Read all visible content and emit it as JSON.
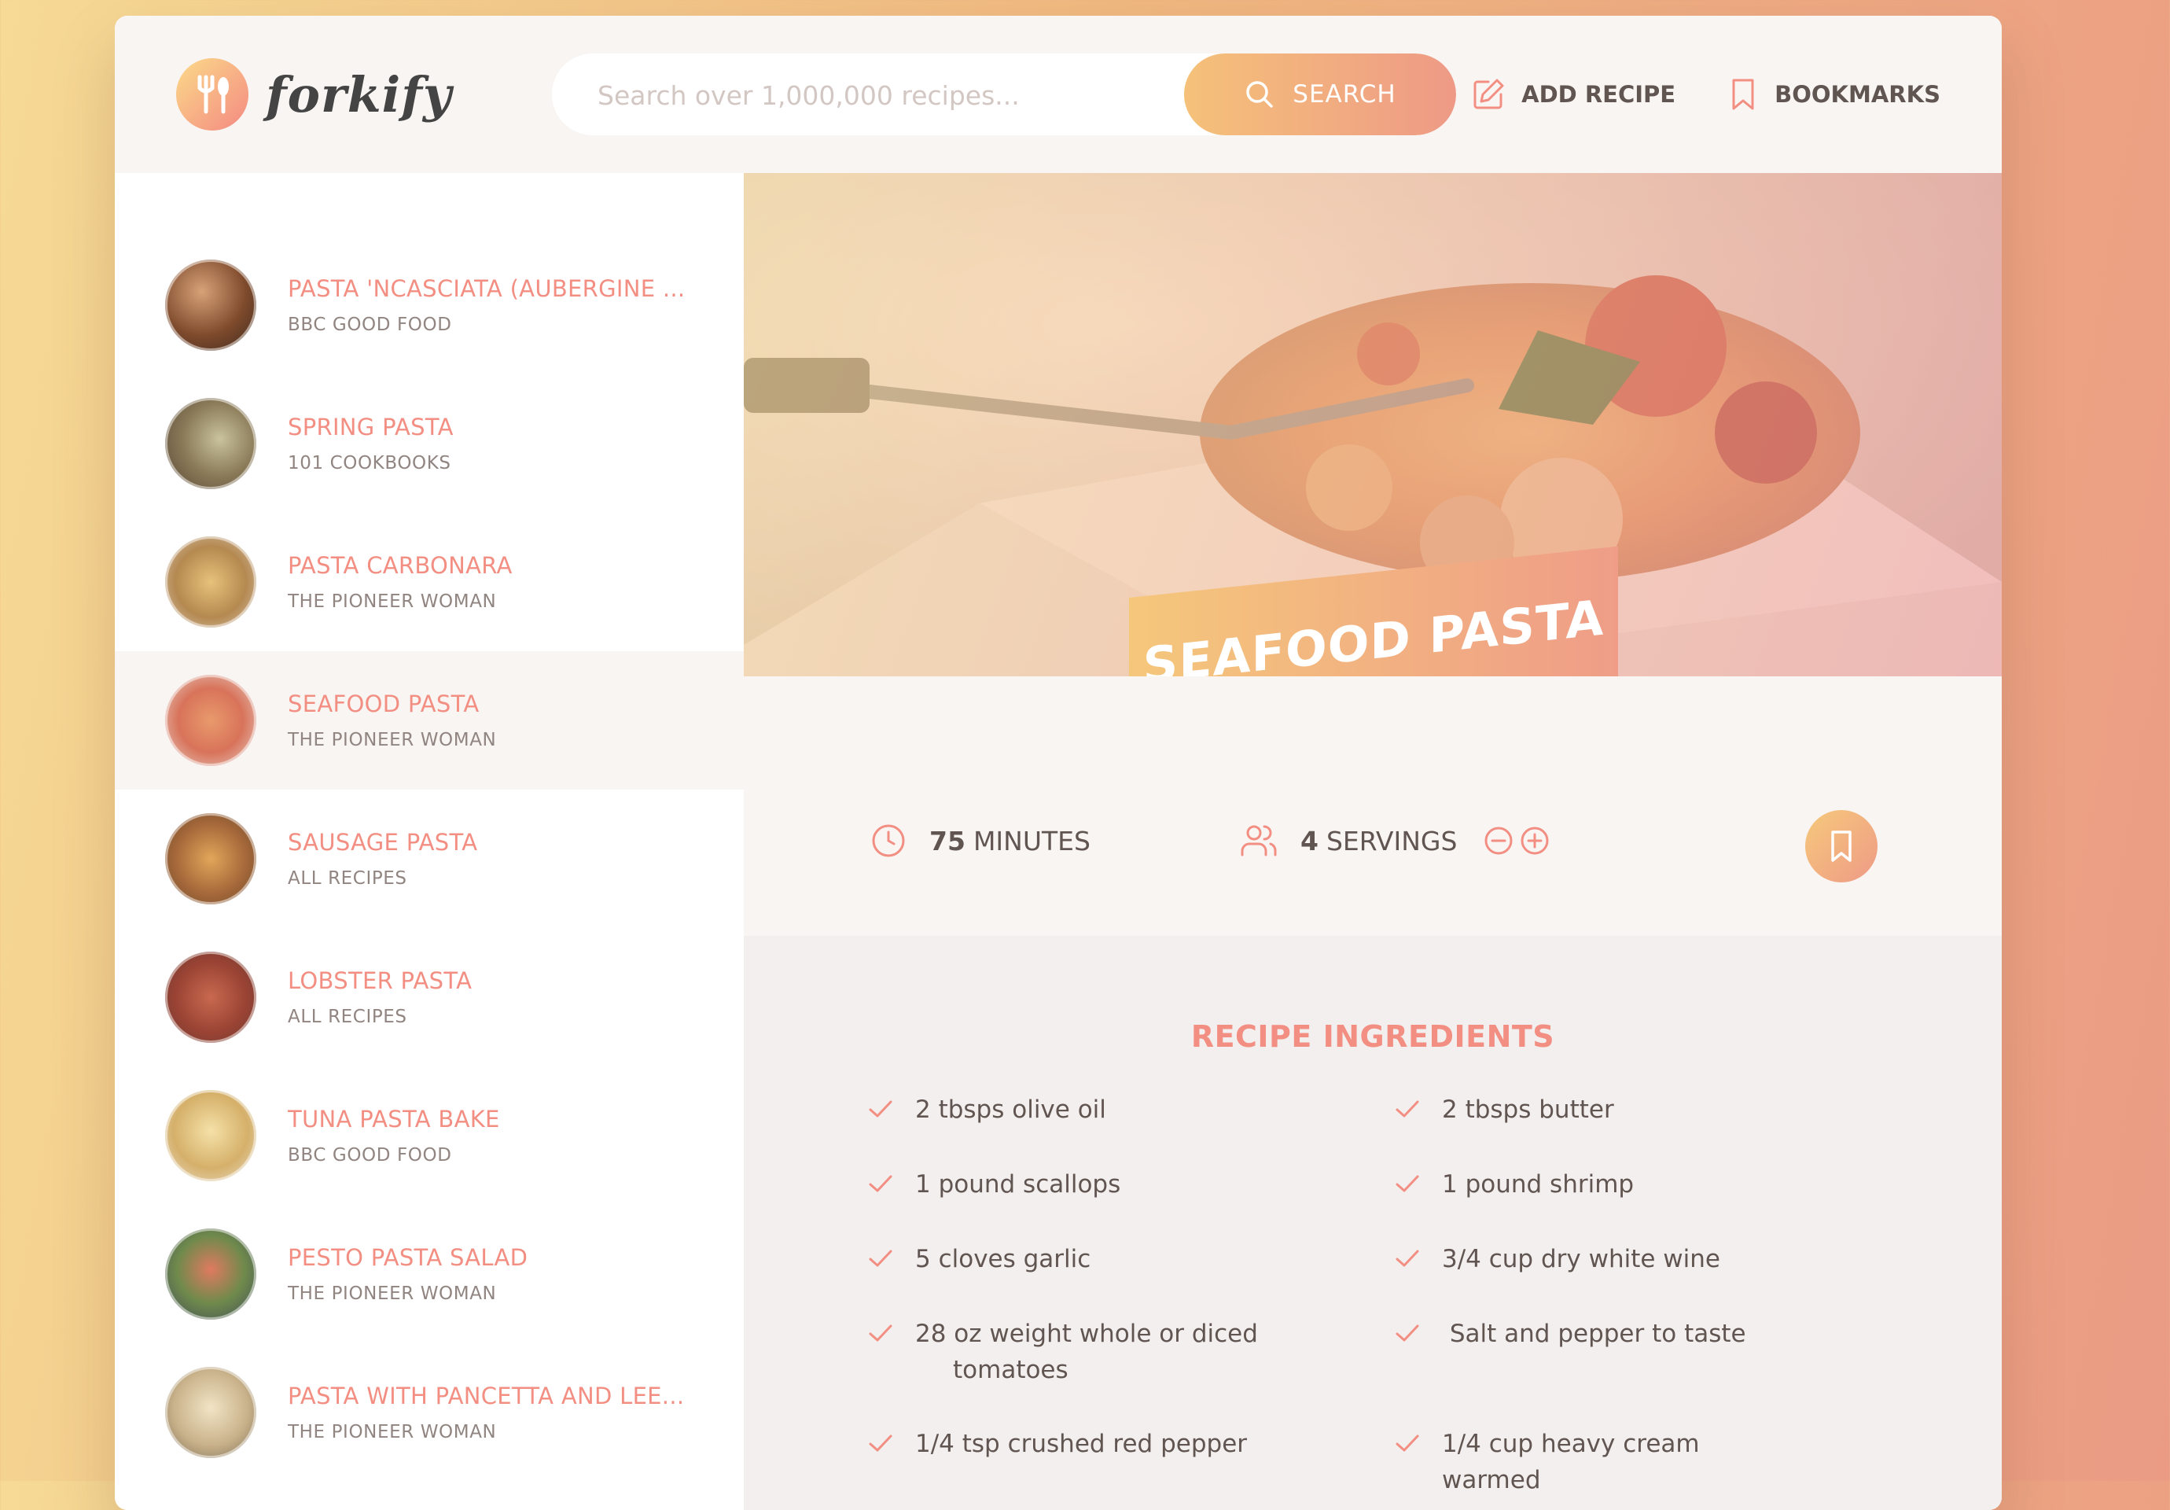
{
  "app": {
    "logo_text": "forkify"
  },
  "search": {
    "placeholder": "Search over 1,000,000 recipes...",
    "button_label": "SEARCH"
  },
  "nav": {
    "add_recipe": "ADD RECIPE",
    "bookmarks": "BOOKMARKS"
  },
  "results": [
    {
      "title": "PASTA 'NCASCIATA (AUBERGINE ...",
      "publisher": "BBC GOOD FOOD",
      "active": false
    },
    {
      "title": "SPRING PASTA",
      "publisher": "101 COOKBOOKS",
      "active": false
    },
    {
      "title": "PASTA CARBONARA",
      "publisher": "THE PIONEER WOMAN",
      "active": false
    },
    {
      "title": "SEAFOOD PASTA",
      "publisher": "THE PIONEER WOMAN",
      "active": true
    },
    {
      "title": "SAUSAGE PASTA",
      "publisher": "ALL RECIPES",
      "active": false
    },
    {
      "title": "LOBSTER PASTA",
      "publisher": "ALL RECIPES",
      "active": false
    },
    {
      "title": "TUNA PASTA BAKE",
      "publisher": "BBC GOOD FOOD",
      "active": false
    },
    {
      "title": "PESTO PASTA SALAD",
      "publisher": "THE PIONEER WOMAN",
      "active": false
    },
    {
      "title": "PASTA WITH PANCETTA AND LEE...",
      "publisher": "THE PIONEER WOMAN",
      "active": false
    }
  ],
  "recipe": {
    "title": "SEAFOOD PASTA",
    "minutes_value": "75",
    "minutes_label": "MINUTES",
    "servings_value": "4",
    "servings_label": "SERVINGS",
    "ingredients_heading": "RECIPE INGREDIENTS",
    "ingredients": [
      "2 tbsps olive oil",
      "2 tbsps butter",
      "1 pound scallops",
      "1 pound shrimp",
      "5 cloves garlic",
      "3/4 cup dry white wine",
      "28 oz weight whole or diced",
      "tomatoes",
      " Salt and pepper to taste",
      "1/4 tsp crushed red pepper",
      "1/4 cup heavy cream warmed"
    ]
  },
  "colors": {
    "accent": "#f38e82",
    "accent_light": "#fbdb89",
    "text": "#615551",
    "background": "#f9f5f3"
  }
}
